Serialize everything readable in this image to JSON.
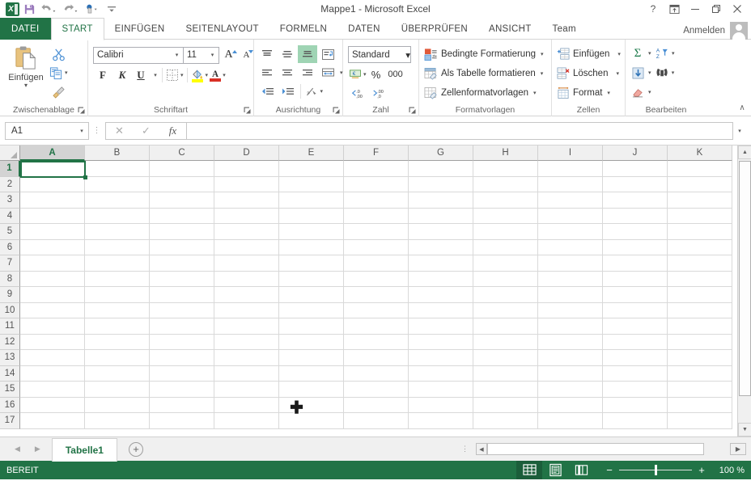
{
  "window": {
    "title": "Mappe1 - Microsoft Excel",
    "help_label": "?",
    "ribbon_display_label": "⤒",
    "minimize_label": "–",
    "restore_label": "❐",
    "close_label": "✕"
  },
  "quick_access": {
    "logo_label": "X",
    "save_label": "Speichern",
    "undo_label": "Rückgängig",
    "redo_label": "Wiederholen",
    "touch_label": "Fingereingabe-/Mausmodus",
    "customize_label": "Symbolleiste für den Schnellzugriff anpassen"
  },
  "tabs": [
    {
      "label": "DATEI",
      "kind": "file"
    },
    {
      "label": "START",
      "kind": "active"
    },
    {
      "label": "EINFÜGEN",
      "kind": "normal"
    },
    {
      "label": "SEITENLAYOUT",
      "kind": "normal"
    },
    {
      "label": "FORMELN",
      "kind": "normal"
    },
    {
      "label": "DATEN",
      "kind": "normal"
    },
    {
      "label": "ÜBERPRÜFEN",
      "kind": "normal"
    },
    {
      "label": "ANSICHT",
      "kind": "normal"
    },
    {
      "label": "Team",
      "kind": "normal"
    }
  ],
  "account": {
    "signin_label": "Anmelden"
  },
  "ribbon": {
    "collapse_label": "∧",
    "clipboard": {
      "group_label": "Zwischenablage",
      "paste_label": "Einfügen",
      "cut_label": "Ausschneiden",
      "copy_label": "Kopieren",
      "format_painter_label": "Format übertragen"
    },
    "font": {
      "group_label": "Schriftart",
      "font_name": "Calibri",
      "font_size": "11",
      "grow_font_label": "A",
      "shrink_font_label": "A",
      "bold_label": "F",
      "italic_label": "K",
      "underline_label": "U",
      "borders_label": "Rahmenlinien",
      "fill_color_label": "Füllfarbe",
      "fill_color_hex": "#ffff00",
      "font_color_label": "Schriftfarbe",
      "font_color_hex": "#d93025"
    },
    "alignment": {
      "group_label": "Ausrichtung",
      "align_top_label": "Oben ausrichten",
      "align_middle_label": "Zentriert ausrichten",
      "align_bottom_label": "Unten ausrichten",
      "wrap_text_label": "Zeilenumbruch",
      "align_left_label": "Linksbündig",
      "align_center_label": "Zentriert",
      "align_right_label": "Rechtsbündig",
      "merge_label": "Verbinden und zentrieren",
      "decrease_indent_label": "Einzug verkleinern",
      "increase_indent_label": "Einzug vergrößern",
      "orientation_label": "Ausrichtung"
    },
    "number": {
      "group_label": "Zahl",
      "format_value": "Standard",
      "accounting_label": "Buchhaltungsformat",
      "percent_label": "%",
      "thousands_label": "000",
      "increase_decimal_label": "Dezimalstelle hinzufügen",
      "decrease_decimal_label": "Dezimalstelle löschen"
    },
    "styles": {
      "group_label": "Formatvorlagen",
      "conditional_label": "Bedingte Formatierung",
      "table_label": "Als Tabelle formatieren",
      "cellstyles_label": "Zellenformatvorlagen"
    },
    "cells": {
      "group_label": "Zellen",
      "insert_label": "Einfügen",
      "delete_label": "Löschen",
      "format_label": "Format"
    },
    "editing": {
      "group_label": "Bearbeiten",
      "autosum_label": "Σ",
      "fill_label": "Füllbereich",
      "clear_label": "Löschen",
      "sortfilter_label": "Sortieren und Filtern",
      "findselect_label": "Suchen und Auswählen"
    }
  },
  "formula_bar": {
    "name_box_value": "A1",
    "cancel_label": "✕",
    "enter_label": "✓",
    "function_label": "fx",
    "input_value": "",
    "expand_label": "⌵"
  },
  "grid": {
    "columns": [
      "A",
      "B",
      "C",
      "D",
      "E",
      "F",
      "G",
      "H",
      "I",
      "J",
      "K"
    ],
    "rows": [
      "1",
      "2",
      "3",
      "4",
      "5",
      "6",
      "7",
      "8",
      "9",
      "10",
      "11",
      "12",
      "13",
      "14",
      "15",
      "16",
      "17"
    ],
    "selected_cell": "A1",
    "selected_column": "A",
    "selected_row": "1",
    "cells": []
  },
  "sheet_tabs": {
    "prev_label": "◀",
    "next_label": "▶",
    "sheets": [
      {
        "label": "Tabelle1",
        "active": true
      }
    ],
    "add_sheet_label": "+"
  },
  "status_bar": {
    "status_text": "BEREIT",
    "view_normal_label": "Normal",
    "view_pagelayout_label": "Seitenlayout",
    "view_pagebreak_label": "Umbruchvorschau",
    "zoom_out_label": "−",
    "zoom_in_label": "+",
    "zoom_value": "100 %"
  },
  "colors": {
    "excel_green": "#217346",
    "status_green": "#217346",
    "selection_green": "#9fd4b4"
  }
}
